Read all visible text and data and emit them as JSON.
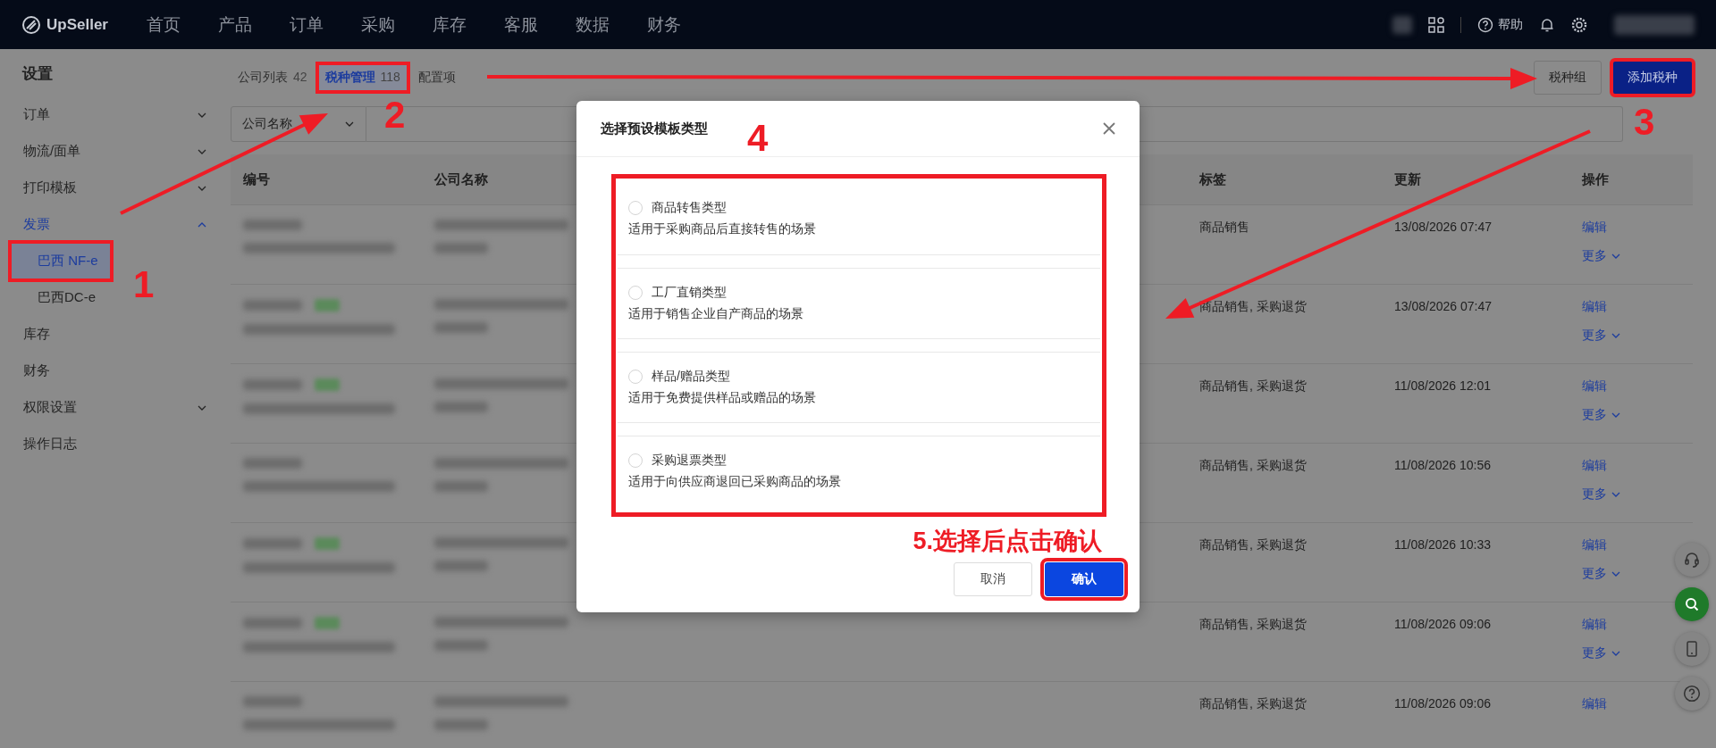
{
  "topbar": {
    "logo": "UpSeller",
    "nav": [
      {
        "label": "首页",
        "selected": false
      },
      {
        "label": "产品",
        "selected": false
      },
      {
        "label": "订单",
        "selected": false
      },
      {
        "label": "采购",
        "selected": false
      },
      {
        "label": "库存",
        "selected": false
      },
      {
        "label": "客服",
        "selected": false
      },
      {
        "label": "数据",
        "selected": false
      },
      {
        "label": "财务",
        "selected": false
      }
    ],
    "help": "帮助"
  },
  "sidebar": {
    "title": "设置",
    "items": [
      {
        "label": "订单",
        "expanded": false,
        "selected": false
      },
      {
        "label": "物流/面单",
        "expanded": false,
        "selected": false
      },
      {
        "label": "打印模板",
        "expanded": false,
        "selected": false
      },
      {
        "label": "发票",
        "expanded": true,
        "selected": false,
        "children": [
          {
            "label": "巴西 NF-e",
            "selected": true,
            "highlighted": true
          },
          {
            "label": "巴西DC-e",
            "selected": false,
            "highlighted": false
          }
        ]
      },
      {
        "label": "库存",
        "selected": false
      },
      {
        "label": "财务",
        "selected": false
      },
      {
        "label": "权限设置",
        "expanded": false,
        "selected": false
      },
      {
        "label": "操作日志",
        "selected": false
      }
    ]
  },
  "tabs": [
    {
      "label": "公司列表",
      "count": "42",
      "selected": false,
      "highlighted": false
    },
    {
      "label": "税种管理",
      "count": "118",
      "selected": true,
      "highlighted": true
    },
    {
      "label": "配置项",
      "selected": false,
      "highlighted": false
    }
  ],
  "actions": [
    {
      "label": "税种组",
      "kind": "default",
      "highlighted": false
    },
    {
      "label": "添加税种",
      "kind": "primary",
      "highlighted": true
    }
  ],
  "filter": {
    "value": "公司名称"
  },
  "table": {
    "columns": [
      "编号",
      "公司名称",
      "标签",
      "更新",
      "操作"
    ],
    "rows": [
      {
        "badge": false,
        "tags": "商品销售",
        "updated": "13/08/2026 07:47",
        "actions": [
          "编辑",
          "更多"
        ]
      },
      {
        "badge": true,
        "tags": "商品销售, 采购退货",
        "updated": "13/08/2026 07:47",
        "actions": [
          "编辑",
          "更多"
        ]
      },
      {
        "badge": true,
        "tags": "商品销售, 采购退货",
        "updated": "11/08/2026 12:01",
        "actions": [
          "编辑",
          "更多"
        ]
      },
      {
        "badge": false,
        "tags": "商品销售, 采购退货",
        "updated": "11/08/2026 10:56",
        "actions": [
          "编辑",
          "更多"
        ]
      },
      {
        "badge": true,
        "tags": "商品销售, 采购退货",
        "updated": "11/08/2026 10:33",
        "actions": [
          "编辑",
          "更多"
        ]
      },
      {
        "badge": true,
        "tags": "商品销售, 采购退货",
        "updated": "11/08/2026 09:06",
        "actions": [
          "编辑",
          "更多"
        ]
      },
      {
        "badge": false,
        "tags": "商品销售, 采购退货",
        "updated": "11/08/2026 09:06",
        "actions": [
          "编辑"
        ]
      }
    ]
  },
  "modal": {
    "title": "选择预设模板类型",
    "options_highlighted": true,
    "options": [
      {
        "title": "商品转售类型",
        "description": "适用于采购商品后直接转售的场景",
        "selected": false
      },
      {
        "title": "工厂直销类型",
        "description": "适用于销售企业自产商品的场景",
        "selected": false
      },
      {
        "title": "样品/赠品类型",
        "description": "适用于免费提供样品或赠品的场景",
        "selected": false
      },
      {
        "title": "采购退票类型",
        "description": "适用于向供应商退回已采购商品的场景",
        "selected": false
      }
    ],
    "hint": "5.选择后点击确认",
    "buttons": [
      {
        "label": "取消",
        "kind": "default",
        "highlighted": false
      },
      {
        "label": "确认",
        "kind": "primary",
        "highlighted": true
      }
    ]
  },
  "annotations": [
    {
      "text": "1"
    },
    {
      "text": "2"
    },
    {
      "text": "3"
    },
    {
      "text": "4"
    }
  ]
}
